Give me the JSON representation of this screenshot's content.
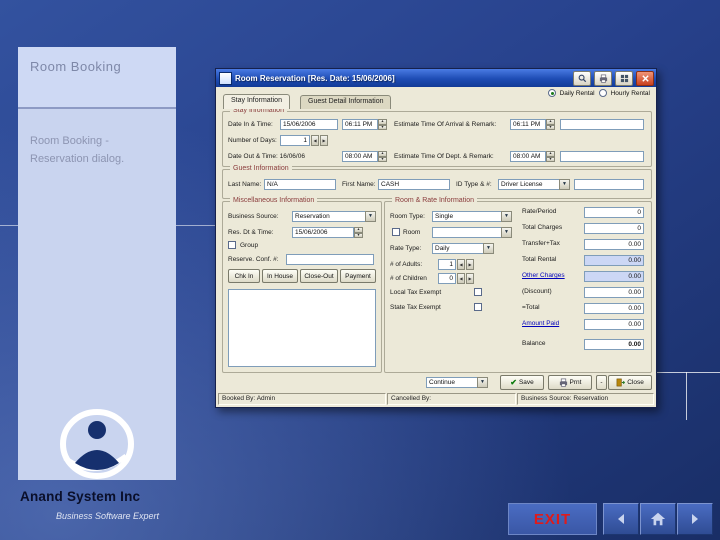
{
  "slide": {
    "title": "Room Booking",
    "subtitle_1": "Room Booking -",
    "subtitle_2": "Reservation dialog.",
    "company": "Anand System Inc",
    "tagline": "Business Software Expert",
    "exit_label": "EXIT",
    "colors": {
      "background": "#27418c",
      "sidebar": "#c9d4ef",
      "exit_red": "#e01b1b"
    }
  },
  "dialog": {
    "title": "Room Reservation [Res. Date: 15/06/2006]",
    "rental": {
      "options": [
        "Daily Rental",
        "Hourly Rental"
      ],
      "selected": "Daily Rental"
    },
    "tabs": [
      "Stay Information",
      "Guest Detail Information"
    ],
    "stay": {
      "legend": "Stay Information",
      "date_in_label": "Date In & Time:",
      "date_in": "15/06/2006",
      "time_in": "06:11 PM",
      "eta_label": "Estimate Time Of Arrival & Remark:",
      "eta_time": "06:11 PM",
      "eta_remark": "",
      "days_label": "Number of Days:",
      "days": "1",
      "date_out_label": "Date Out & Time: 16/06/06",
      "time_out": "08:00 AM",
      "etd_label": "Estimate Time Of Dept. & Remark:",
      "etd_time": "08:00 AM",
      "etd_remark": ""
    },
    "guest": {
      "legend": "Guest Information",
      "last_name_label": "Last Name:",
      "last_name": "N/A",
      "first_name_label": "First Name:",
      "first_name": "CASH",
      "id_label": "ID Type & #:",
      "id_type": "Driver License",
      "id_number": ""
    },
    "misc": {
      "legend": "Miscellaneous Information",
      "business_source_label": "Business Source:",
      "business_source": "Reservation",
      "res_dt_label": "Res. Dt & Time:",
      "res_dt": "15/06/2006",
      "group_label": "Group",
      "conf_label": "Reserve. Conf. #:",
      "conf_value": "",
      "buttons": [
        "Chk In",
        "In House",
        "Close-Out",
        "Payment"
      ],
      "remarks": ""
    },
    "room": {
      "legend": "Room & Rate Information",
      "room_type_label": "Room Type:",
      "room_type": "Single",
      "room_label": "Room",
      "room_value": "",
      "rate_type_label": "Rate Type:",
      "rate_type": "Daily",
      "adults_label": "# of Adults:",
      "adults": "1",
      "children_label": "# of Children",
      "children": "0",
      "local_tax_label": "Local Tax Exempt",
      "state_tax_label": "State Tax Exempt"
    },
    "money": {
      "rows": [
        {
          "label": "Rate/Period",
          "value": "0"
        },
        {
          "label": "Total Charges",
          "value": "0"
        },
        {
          "label": "Transfer+Tax",
          "value": "0.00"
        },
        {
          "label": "Total Rental",
          "value": "0.00"
        },
        {
          "label": "Other Charges",
          "value": "0.00"
        },
        {
          "label": "(Discount)",
          "value": "0.00"
        },
        {
          "label": "=Total",
          "value": "0.00"
        },
        {
          "label": "Amount Paid",
          "value": "0.00"
        },
        {
          "label": "Balance",
          "value": "0.00"
        }
      ]
    },
    "footer": {
      "continue_label": "Continue",
      "save": "Save",
      "print": "Prnt",
      "more": "-",
      "close": "Close"
    },
    "status": {
      "booked_by": "Booked By: Admin",
      "cancelled_by": "Cancelled By:",
      "business_source": "Business Source: Reservation"
    },
    "icons": {
      "titlebar": [
        "search-icon",
        "print-icon",
        "grid-icon",
        "close-icon"
      ],
      "footer": [
        "save-check-icon",
        "printer-icon",
        "door-icon"
      ],
      "nav": [
        "prev-icon",
        "home-icon",
        "next-icon"
      ]
    }
  }
}
